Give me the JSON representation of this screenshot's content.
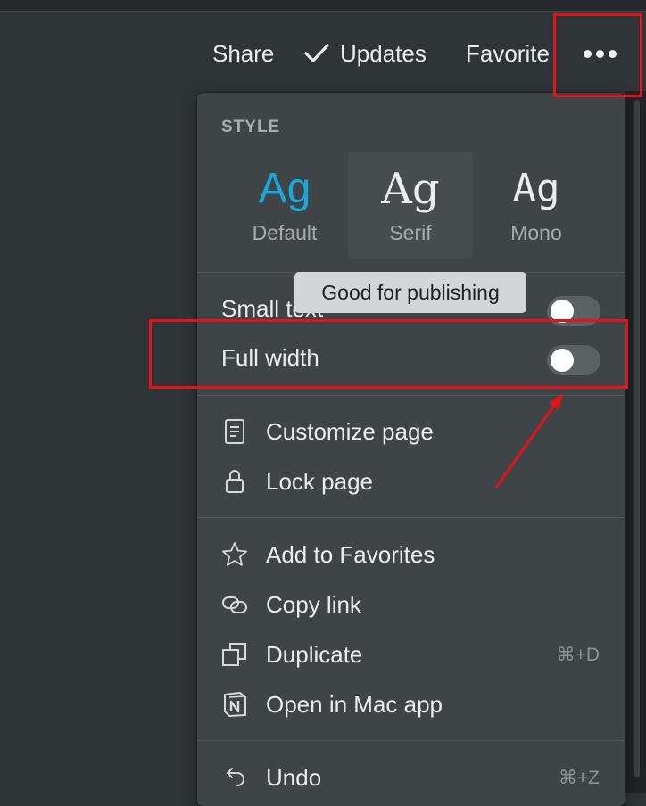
{
  "topbar": {
    "share_label": "Share",
    "updates_label": "Updates",
    "favorite_label": "Favorite",
    "more_icon": "more-dots-icon"
  },
  "menu": {
    "style_header": "STYLE",
    "styles": [
      {
        "glyph": "Ag",
        "label": "Default",
        "accent": "#1aa7d9"
      },
      {
        "glyph": "Ag",
        "label": "Serif"
      },
      {
        "glyph": "Ag",
        "label": "Mono"
      }
    ],
    "tooltip": "Good for publishing",
    "toggles": [
      {
        "label": "Small text",
        "on": false
      },
      {
        "label": "Full width",
        "on": false
      }
    ],
    "page_items": [
      {
        "label": "Customize page",
        "icon": "document-icon"
      },
      {
        "label": "Lock page",
        "icon": "lock-icon"
      }
    ],
    "actions": [
      {
        "label": "Add to Favorites",
        "icon": "star-icon",
        "shortcut": ""
      },
      {
        "label": "Copy link",
        "icon": "link-icon",
        "shortcut": ""
      },
      {
        "label": "Duplicate",
        "icon": "duplicate-icon",
        "shortcut": "⌘+D"
      },
      {
        "label": "Open in Mac app",
        "icon": "notion-icon",
        "shortcut": ""
      }
    ],
    "edit_items": [
      {
        "label": "Undo",
        "icon": "undo-icon",
        "shortcut": "⌘+Z"
      }
    ]
  },
  "annotation_color": "#e3131b"
}
